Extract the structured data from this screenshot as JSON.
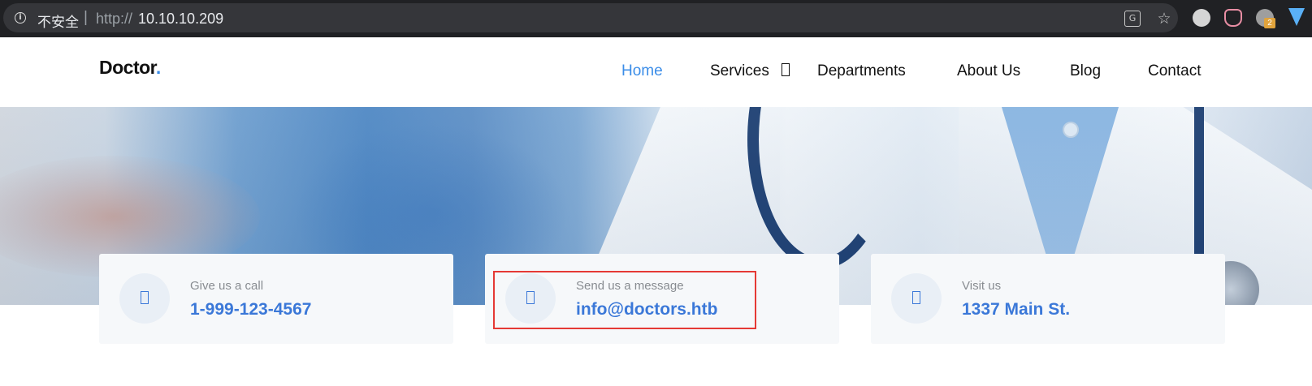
{
  "browser": {
    "security_label": "不安全",
    "separator": "|",
    "url_scheme": "http://",
    "url_host": "10.10.10.209",
    "extension_badge": "2",
    "icons": [
      "info-icon",
      "translate-icon",
      "star-icon",
      "ghostery-icon",
      "cat-icon",
      "extension-icon",
      "diamond-icon"
    ]
  },
  "site": {
    "logo_text": "Doctor",
    "logo_dot": ".",
    "nav": [
      {
        "label": "Home",
        "active": true
      },
      {
        "label": "Services",
        "active": false,
        "has_dropdown": true
      },
      {
        "label": "Departments",
        "active": false
      },
      {
        "label": "About Us",
        "active": false
      },
      {
        "label": "Blog",
        "active": false
      },
      {
        "label": "Contact",
        "active": false
      }
    ]
  },
  "contact_cards": [
    {
      "label": "Give us a call",
      "value": "1-999-123-4567",
      "icon": "phone-icon"
    },
    {
      "label": "Send us a message",
      "value": "info@doctors.htb",
      "icon": "envelope-icon"
    },
    {
      "label": "Visit us",
      "value": "1337 Main St.",
      "icon": "map-pin-icon"
    }
  ],
  "colors": {
    "accent": "#3b8de8",
    "card_value": "#3b78d8",
    "highlight": "#e53935",
    "browser_bg": "#202124"
  }
}
